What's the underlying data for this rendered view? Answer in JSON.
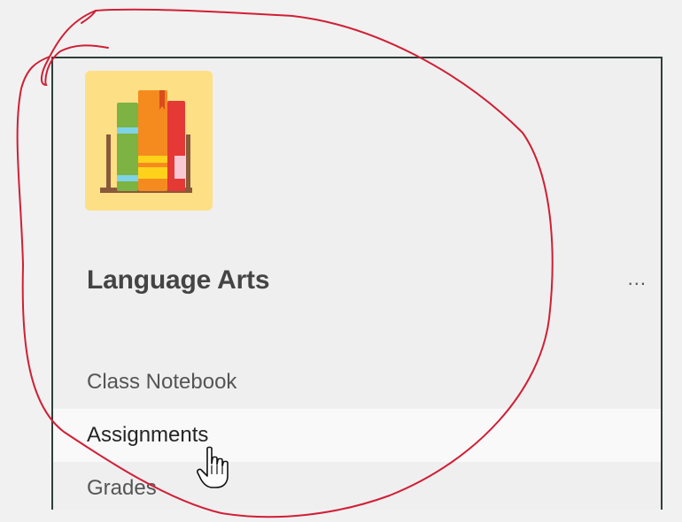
{
  "team": {
    "name": "Language Arts",
    "avatar_icon": "books-icon",
    "avatar_bg": "#fddf85",
    "more_label": "..."
  },
  "channels": [
    {
      "label": "Class Notebook",
      "state": "normal"
    },
    {
      "label": "Assignments",
      "state": "hover"
    },
    {
      "label": "Grades",
      "state": "normal"
    }
  ],
  "annotation": {
    "color": "#d01f35",
    "icon": "freehand-circle-annotation"
  },
  "cursor": {
    "icon": "hand-pointer-cursor-icon"
  }
}
